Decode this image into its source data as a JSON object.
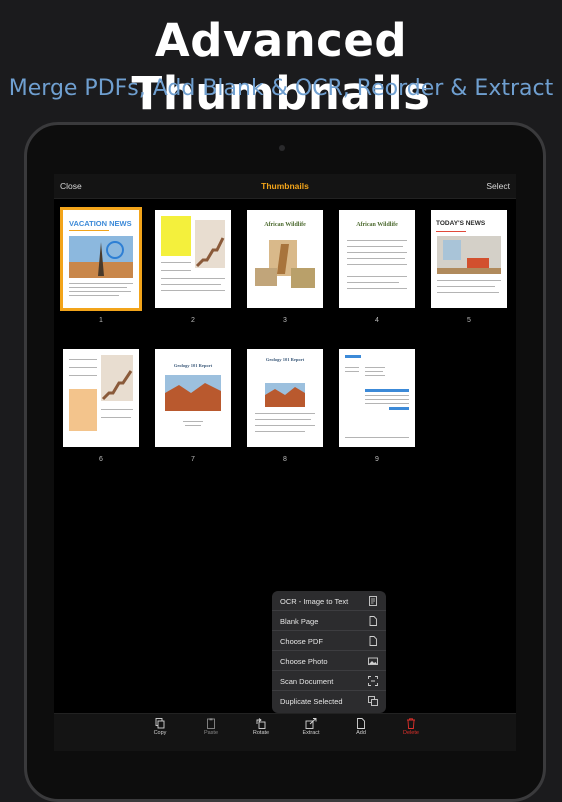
{
  "promo": {
    "headline": "Advanced Thumbnails",
    "subheadline": "Merge PDFs, Add Blank & OCR, Reorder & Extract"
  },
  "navbar": {
    "close_label": "Close",
    "title": "Thumbnails",
    "select_label": "Select"
  },
  "pages": [
    {
      "number": "1",
      "heading": "VACATION NEWS",
      "selected": true
    },
    {
      "number": "2",
      "selected": false
    },
    {
      "number": "3",
      "heading": "African Wildlife",
      "selected": false
    },
    {
      "number": "4",
      "heading": "African Wildlife",
      "selected": false
    },
    {
      "number": "5",
      "heading": "TODAY'S NEWS",
      "selected": false
    },
    {
      "number": "6",
      "selected": false
    },
    {
      "number": "7",
      "heading": "Geology 101 Report",
      "selected": false
    },
    {
      "number": "8",
      "heading": "Geology 101 Report",
      "selected": false
    },
    {
      "number": "9",
      "selected": false
    }
  ],
  "add_menu": {
    "items": [
      {
        "label": "OCR - Image to Text",
        "icon": "ocr-doc-icon"
      },
      {
        "label": "Blank Page",
        "icon": "blank-page-icon"
      },
      {
        "label": "Choose PDF",
        "icon": "pdf-file-icon"
      },
      {
        "label": "Choose Photo",
        "icon": "photo-icon"
      },
      {
        "label": "Scan Document",
        "icon": "scan-icon"
      },
      {
        "label": "Duplicate Selected",
        "icon": "duplicate-icon"
      }
    ]
  },
  "toolbar": {
    "copy_label": "Copy",
    "paste_label": "Paste",
    "rotate_label": "Rotate",
    "extract_label": "Extract",
    "add_label": "Add",
    "delete_label": "Delete"
  },
  "colors": {
    "accent": "#f2a41a",
    "delete": "#e0312b",
    "subheadline": "#6f9fd0"
  }
}
